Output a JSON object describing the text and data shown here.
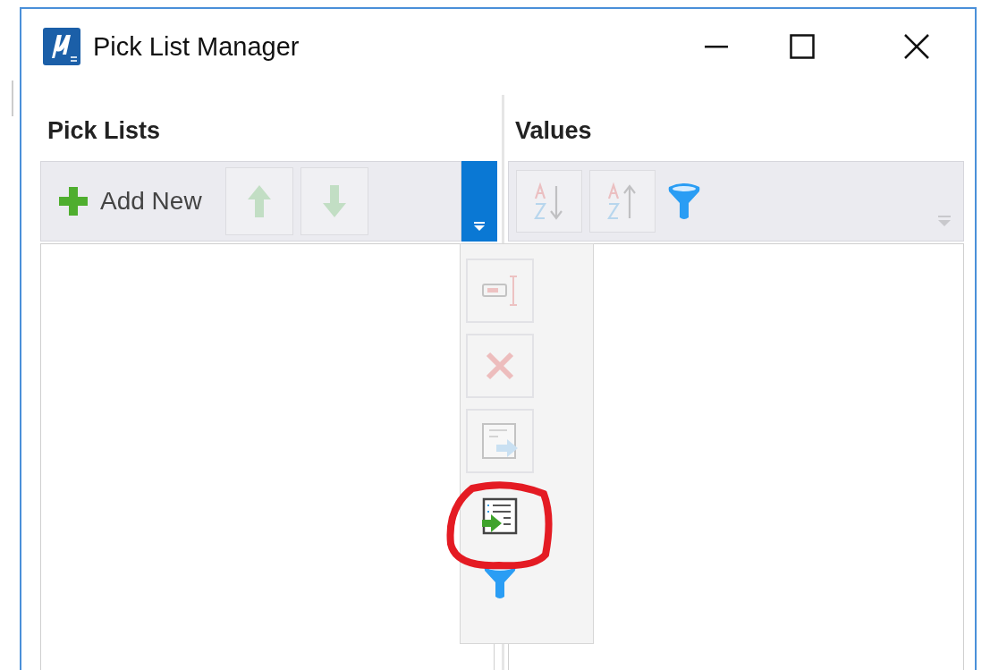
{
  "window": {
    "title": "Pick List Manager"
  },
  "pick_lists": {
    "heading": "Pick Lists",
    "add_label": "Add New",
    "buttons": [
      {
        "disabled": true
      },
      {
        "disabled": true
      }
    ]
  },
  "values": {
    "heading": "Values",
    "buttons": [
      {
        "disabled": true
      },
      {
        "disabled": true
      },
      {
        "disabled": false
      }
    ]
  },
  "overflow_menu": {
    "expanded": true,
    "items": [
      {
        "disabled": true
      },
      {
        "disabled": true
      },
      {
        "disabled": true
      },
      {
        "disabled": false
      },
      {
        "disabled": false
      }
    ]
  }
}
